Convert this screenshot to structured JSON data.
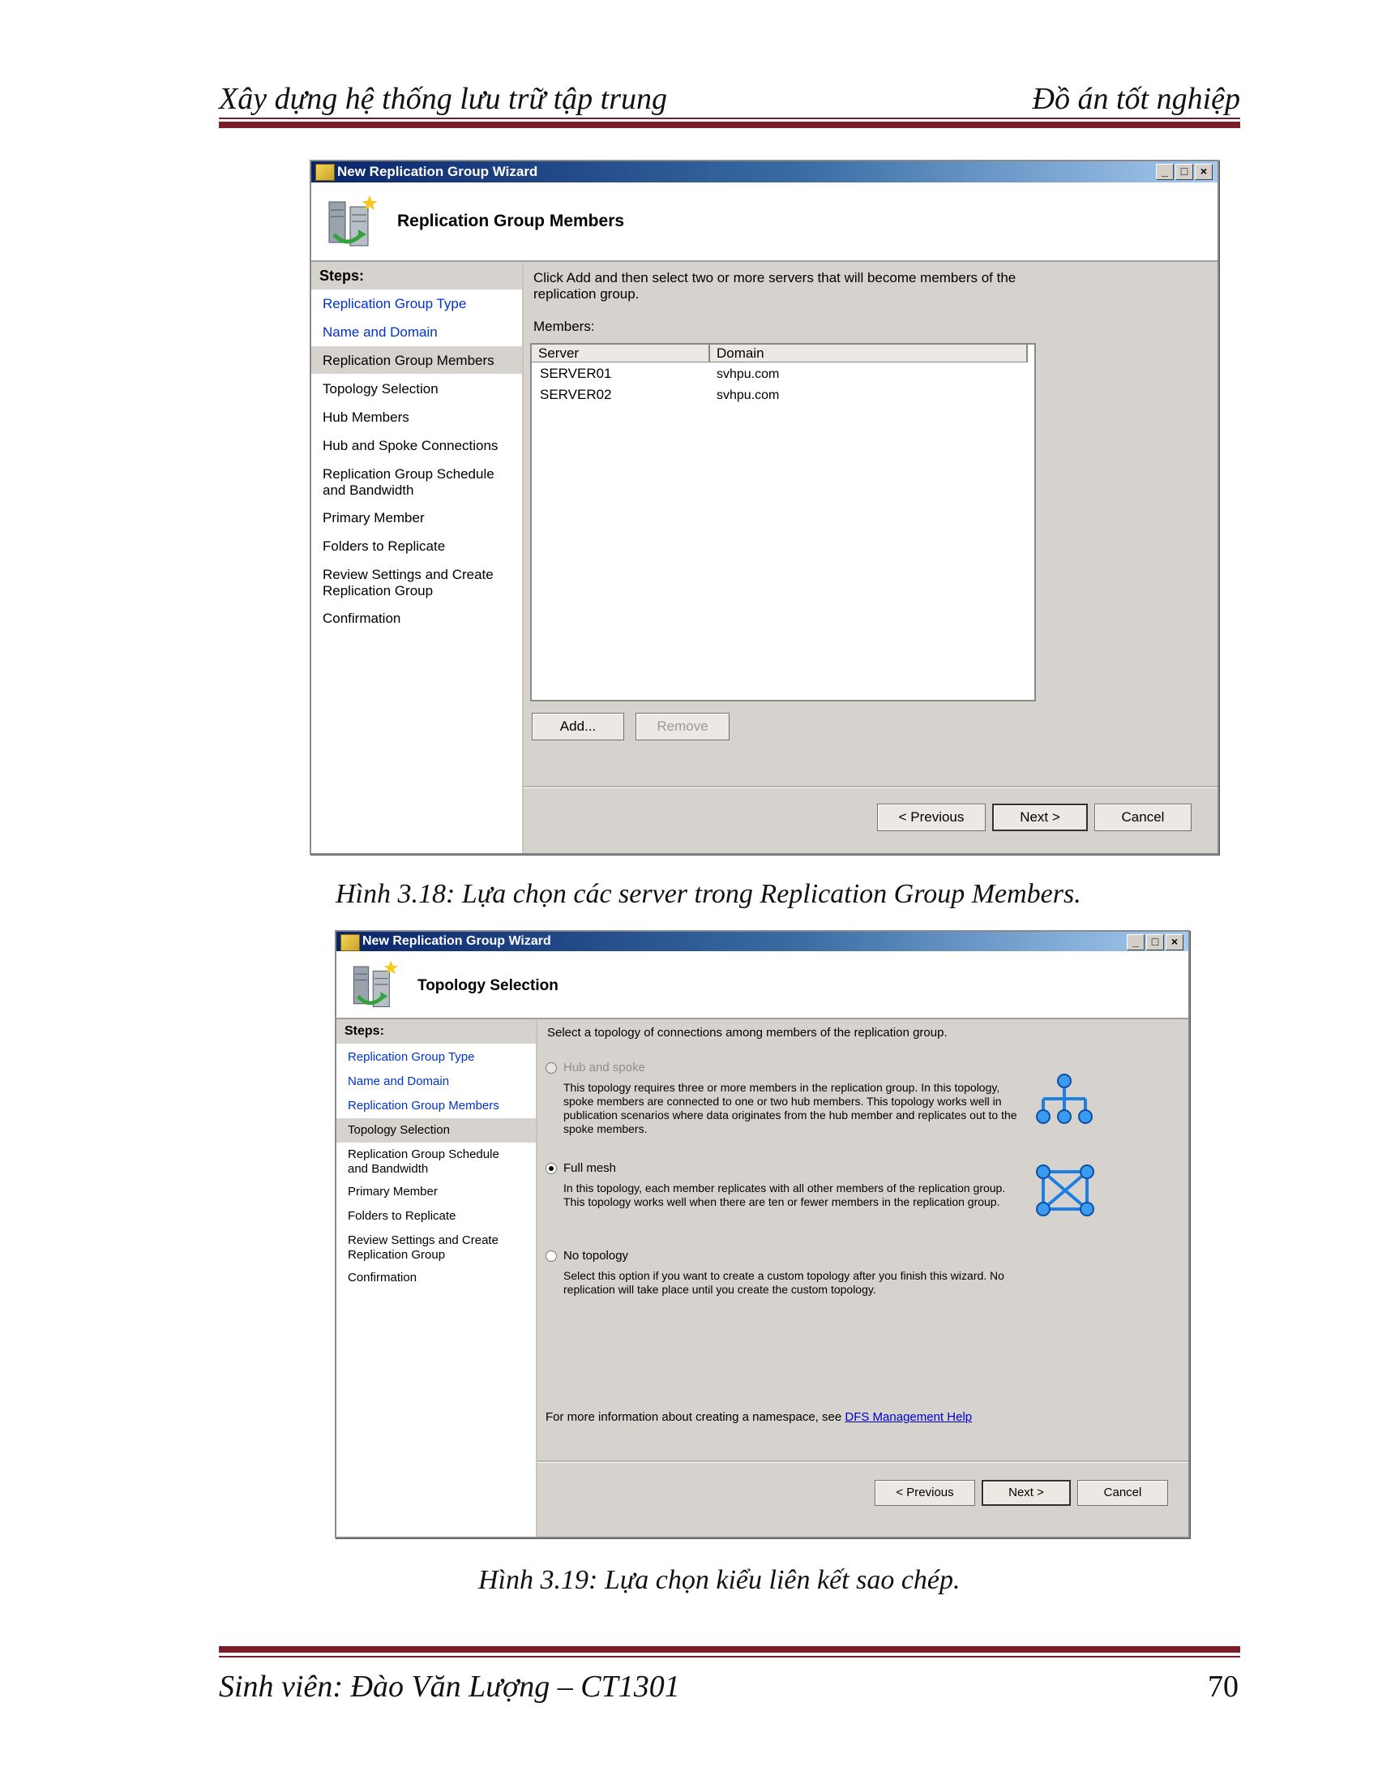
{
  "page": {
    "header_left": "Xây dựng hệ thống lưu trữ tập trung",
    "header_right": "Đồ án tốt nghiệp",
    "footer_left": "Sinh viên: Đào Văn Lượng – CT1301",
    "page_number": "70"
  },
  "figure1": {
    "caption": "Hình 3.18: Lựa chọn các server trong Replication Group Members.",
    "window": {
      "title": "New Replication Group Wizard",
      "banner_title": "Replication Group Members",
      "steps_header": "Steps:",
      "steps": [
        {
          "label": "Replication Group Type",
          "state": "done"
        },
        {
          "label": "Name and Domain",
          "state": "done"
        },
        {
          "label": "Replication Group Members",
          "state": "current"
        },
        {
          "label": "Topology Selection",
          "state": "pending"
        },
        {
          "label": "Hub Members",
          "state": "pending"
        },
        {
          "label": "Hub and Spoke Connections",
          "state": "pending"
        },
        {
          "label": "Replication Group Schedule and Bandwidth",
          "state": "pending"
        },
        {
          "label": "Primary Member",
          "state": "pending"
        },
        {
          "label": "Folders to Replicate",
          "state": "pending"
        },
        {
          "label": "Review Settings and Create Replication Group",
          "state": "pending"
        },
        {
          "label": "Confirmation",
          "state": "pending"
        }
      ],
      "instructions": "Click Add and then select two or more servers that will become members of the replication group.",
      "members_label": "Members:",
      "columns": [
        "Server",
        "Domain"
      ],
      "rows": [
        {
          "server": "SERVER01",
          "domain": "svhpu.com"
        },
        {
          "server": "SERVER02",
          "domain": "svhpu.com"
        }
      ],
      "add_button": "Add...",
      "remove_button": "Remove",
      "previous_button": "< Previous",
      "next_button": "Next >",
      "cancel_button": "Cancel"
    }
  },
  "figure2": {
    "caption": "Hình 3.19: Lựa chọn kiểu liên kết sao chép.",
    "window": {
      "title": "New Replication Group Wizard",
      "banner_title": "Topology Selection",
      "steps_header": "Steps:",
      "steps": [
        {
          "label": "Replication Group Type",
          "state": "done"
        },
        {
          "label": "Name and Domain",
          "state": "done"
        },
        {
          "label": "Replication Group Members",
          "state": "done"
        },
        {
          "label": "Topology Selection",
          "state": "current"
        },
        {
          "label": "Replication Group Schedule and Bandwidth",
          "state": "pending"
        },
        {
          "label": "Primary Member",
          "state": "pending"
        },
        {
          "label": "Folders to Replicate",
          "state": "pending"
        },
        {
          "label": "Review Settings and Create Replication Group",
          "state": "pending"
        },
        {
          "label": "Confirmation",
          "state": "pending"
        }
      ],
      "instructions": "Select a topology of connections among members of the replication group.",
      "options": [
        {
          "label": "Hub and spoke",
          "selected": false,
          "enabled": false,
          "description": "This topology requires three or more members in the replication group. In this topology, spoke members are connected to one or two hub members. This topology works well in publication scenarios where data originates from the hub member and replicates out to the spoke members.",
          "icon": "hub-spoke-icon"
        },
        {
          "label": "Full mesh",
          "selected": true,
          "enabled": true,
          "description": "In this topology, each member replicates with all other members of the replication group. This topology works well when there are ten or fewer members in the replication group.",
          "icon": "full-mesh-icon"
        },
        {
          "label": "No topology",
          "selected": false,
          "enabled": true,
          "description": "Select this option if you want to create a custom topology after you finish this wizard. No replication will take place until you create the custom topology."
        }
      ],
      "help_text": "For more information about creating a namespace, see",
      "help_link": "DFS Management Help",
      "previous_button": "< Previous",
      "next_button": "Next >",
      "cancel_button": "Cancel"
    }
  },
  "colors": {
    "rule": "#7a1e2a",
    "titlebar_start": "#0a246a",
    "titlebar_end": "#a6caf0",
    "dialog_gray": "#d6d3ce",
    "step_done": "#0033cc",
    "topology_icon": "#1e7fe0"
  }
}
